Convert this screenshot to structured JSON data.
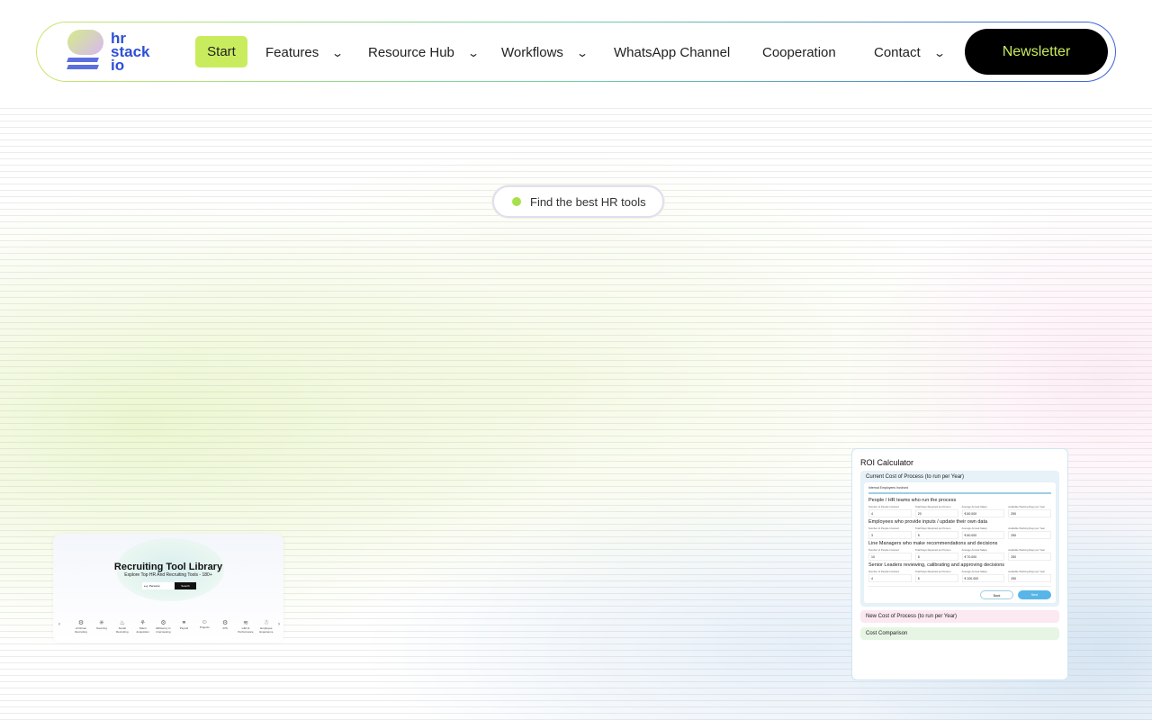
{
  "nav": {
    "logo_text": [
      "hr",
      "stack",
      "io"
    ],
    "items": [
      {
        "label": "Start",
        "active": true
      },
      {
        "label": "Features",
        "dropdown": true
      },
      {
        "label": "Resource Hub",
        "dropdown": true
      },
      {
        "label": "Workflows",
        "dropdown": true
      },
      {
        "label": "WhatsApp Channel"
      },
      {
        "label": "Cooperation"
      },
      {
        "label": "Contact",
        "dropdown": true
      }
    ],
    "cta": "Newsletter",
    "accent": "#c9ec5e"
  },
  "hero": {
    "badge": "Find the best HR tools"
  },
  "library_card": {
    "title": "Recruiting Tool Library",
    "subtitle": "Explore Top HR And Recruiting Tools - 180+",
    "search_placeholder": "e.g. Personio",
    "search_button": "Search",
    "categories": [
      "AI Driven Recruiting",
      "Sourcing",
      "Social Recruiting",
      "Talent Acquisition",
      "Efficiency in Interviewing",
      "Payroll",
      "Projects",
      "ATS",
      "L&D & Performance",
      "Employee Experience"
    ]
  },
  "roi": {
    "title": "ROI Calculator",
    "current": "Current Cost of Process (to run per Year)",
    "tab": "Internal Employees Involved",
    "columns": [
      "Number of People Involved",
      "Total Days Required per Person",
      "Average Annual Salary",
      "Available Working Days per Year"
    ],
    "groups": [
      {
        "title": "People / HR teams who run the process",
        "values": [
          "4",
          "20",
          "€ 60.000",
          "250"
        ]
      },
      {
        "title": "Employees who provide inputs / update their own data",
        "values": [
          "3",
          "5",
          "€ 60.000",
          "250"
        ]
      },
      {
        "title": "Line Managers who make recommendations and decisions",
        "values": [
          "10",
          "5",
          "€ 70.000",
          "250"
        ]
      },
      {
        "title": "Senior Leaders reviewing, calibrating and approving decisions",
        "values": [
          "4",
          "5",
          "€ 100.000",
          "250"
        ]
      }
    ],
    "back": "Back",
    "next": "Next",
    "new": "New Cost of Process (to run per Year)",
    "comparison": "Cost Comparison"
  }
}
